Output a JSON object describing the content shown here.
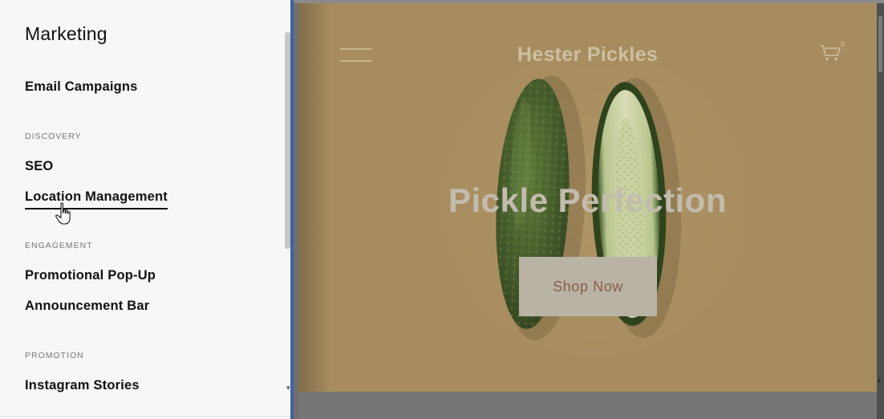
{
  "sidebar": {
    "title": "Marketing",
    "items": {
      "email_campaigns": "Email Campaigns",
      "seo": "SEO",
      "location_management": "Location Management",
      "promotional_popup": "Promotional Pop-Up",
      "announcement_bar": "Announcement Bar",
      "instagram_stories": "Instagram Stories"
    },
    "sections": {
      "discovery": "DISCOVERY",
      "engagement": "ENGAGEMENT",
      "promotion": "PROMOTION"
    }
  },
  "preview": {
    "site_title": "Hester Pickles",
    "cart_count": "0",
    "hero_heading": "Pickle Perfection",
    "cta_label": "Shop Now"
  },
  "colors": {
    "divider_accent": "#3f63a4",
    "site_background": "#a68c5e",
    "cta_text": "#8b5a43"
  },
  "icons": [
    "hamburger-menu-icon",
    "shopping-cart-icon",
    "hand-pointer-cursor-icon"
  ]
}
